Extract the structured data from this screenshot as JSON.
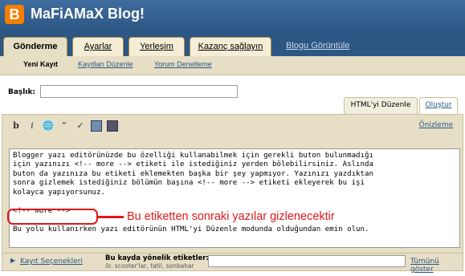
{
  "app": {
    "logo_letter": "B",
    "blog_name": "MaFiAMaX Blog!"
  },
  "tabs": [
    {
      "label": "Gönderme"
    },
    {
      "label": "Ayarlar"
    },
    {
      "label": "Yerleşim"
    },
    {
      "label": "Kazanç sağlayın"
    }
  ],
  "view_blog_link": "Blogu Görüntüle",
  "subtabs": [
    {
      "label": "Yeni Kayıt"
    },
    {
      "label": "Kayıtları Düzenle"
    },
    {
      "label": "Yorum Denetleme"
    }
  ],
  "post": {
    "title_label": "Başlık:",
    "title_value": ""
  },
  "modes": {
    "html_label": "HTML'yi Düzenle",
    "compose_label": "Oluştur"
  },
  "toolbar": {
    "bold": "b",
    "italic": "i",
    "icons": [
      "bold-icon",
      "italic-icon",
      "link-icon",
      "quote-icon",
      "spellcheck-icon",
      "image-icon",
      "video-icon"
    ],
    "preview_label": "Önizleme"
  },
  "editor": {
    "paragraph1": "Blogger yazı editörünüzde bu özelliği kullanabilmek için gerekli buton bulunmadığı\niçin yazınızı <!-- more --> etiketi ile istediğiniz yerden bölebilirsiniz. Aslında\nbuton da yazınıza bu etiketi eklemekten başka bir şey yapmıyor. Yazınızı yazdıktan\nsonra gizlemek istediğiniz bölümün başına <!-- more --> etiketi ekleyerek bu işi\nkolayca yapıyorsunuz.",
    "code_line": "<!-- more -->",
    "paragraph2": "Bu yolu kullanırken yazı editörünün HTML'yi Düzenle modunda olduğundan emin olun."
  },
  "annotation": {
    "text": "Bu etiketten sonraki yazılar gizlenecektir",
    "color": "#e0181b"
  },
  "footer": {
    "options_link": "Kayıt Seçenekleri",
    "labels_title": "Bu kayda yönelik etiketler:",
    "labels_example": "ör. scooter'lar, tatil, sonbahar",
    "labels_value": "",
    "show_all_link": "Tümünü göster"
  },
  "colors": {
    "header_blue": "#2c5683",
    "tan": "#e6dfc6",
    "accent_orange": "#f57d00"
  }
}
